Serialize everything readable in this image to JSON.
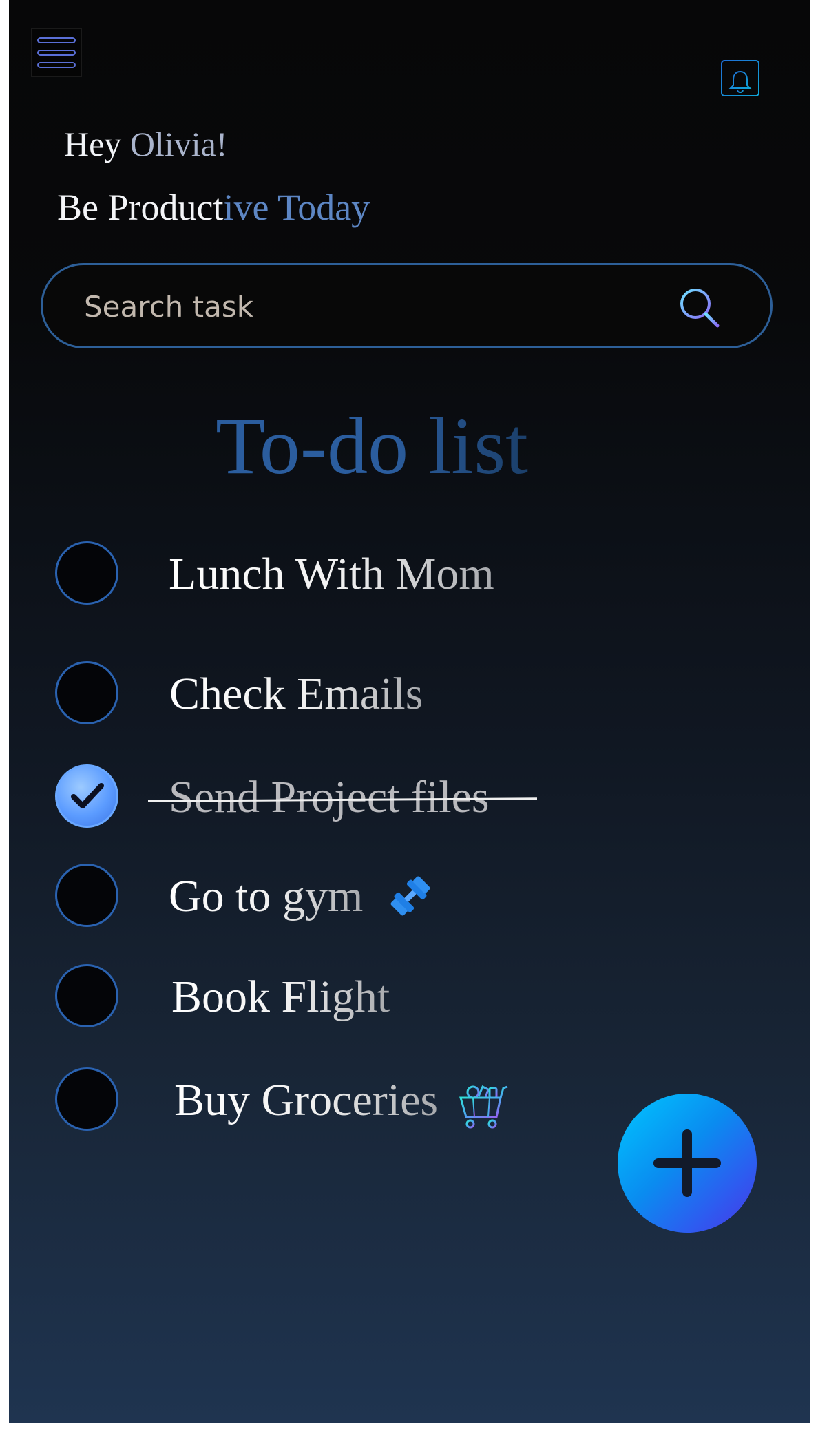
{
  "header": {
    "menu_icon": "hamburger-menu-icon",
    "calendar_icon": "calendar-bell-icon",
    "greeting_prefix": "Hey ",
    "greeting_name": "Olivia!",
    "tagline_main": "Be Product",
    "tagline_accent": "ive Today"
  },
  "search": {
    "placeholder": "Search task",
    "icon": "search-icon"
  },
  "heading": "To-do list",
  "tasks": [
    {
      "label": "Lunch With Mom",
      "done": false
    },
    {
      "label": "Check Emails",
      "done": false
    },
    {
      "label": "Send Project files",
      "done": true
    },
    {
      "label": "Go to gym",
      "done": false,
      "icon": "dumbbell-icon"
    },
    {
      "label": "Book Flight",
      "done": false
    },
    {
      "label": "Buy Groceries",
      "done": false,
      "icon": "shopping-cart-icon"
    }
  ],
  "fab": {
    "icon": "plus-icon"
  },
  "colors": {
    "accent_blue": "#2b5d9e",
    "check_done": "#5c9cff",
    "fab_start": "#00c7ff",
    "fab_end": "#4a35e6"
  }
}
